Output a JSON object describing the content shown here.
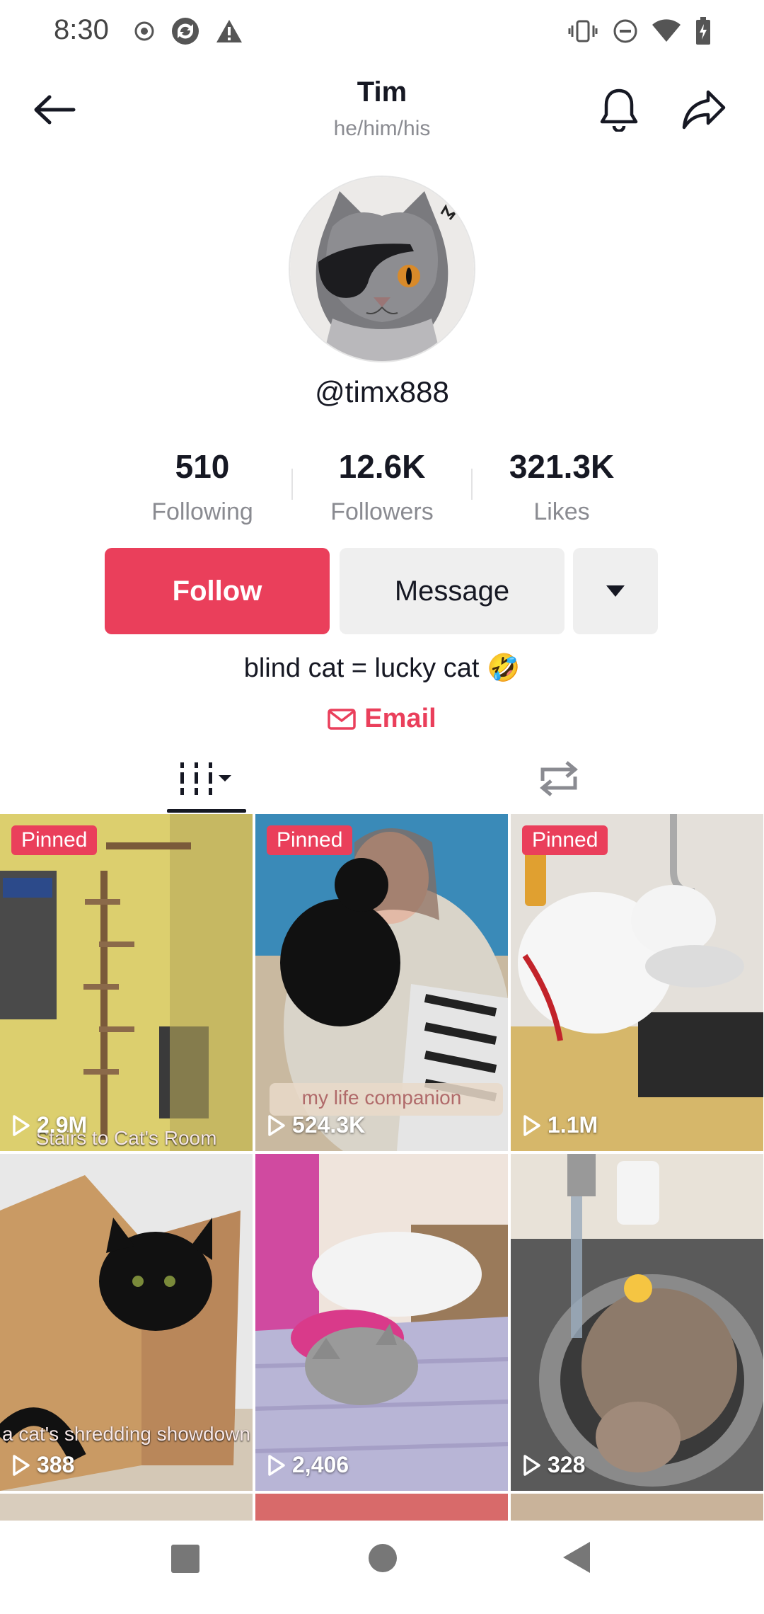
{
  "status_bar": {
    "time": "8:30"
  },
  "header": {
    "title": "Tim",
    "pronouns": "he/him/his"
  },
  "profile": {
    "username": "@timx888",
    "stats": [
      {
        "value": "510",
        "label": "Following"
      },
      {
        "value": "12.6K",
        "label": "Followers"
      },
      {
        "value": "321.3K",
        "label": "Likes"
      }
    ],
    "follow_label": "Follow",
    "message_label": "Message",
    "bio": "blind cat = lucky cat 🤣",
    "email_label": "Email"
  },
  "colors": {
    "accent": "#ea3f5b",
    "text": "#161823",
    "muted": "#8a8b91"
  },
  "videos": [
    {
      "badge": "Pinned",
      "views": "2.9M",
      "caption": "Stairs to Cat's Room"
    },
    {
      "badge": "Pinned",
      "views": "524.3K",
      "caption": "my life companion"
    },
    {
      "badge": "Pinned",
      "views": "1.1M",
      "caption": ""
    },
    {
      "badge": "",
      "views": "388",
      "caption": "a cat's shredding showdown"
    },
    {
      "badge": "",
      "views": "2,406",
      "caption": ""
    },
    {
      "badge": "",
      "views": "328",
      "caption": ""
    }
  ]
}
